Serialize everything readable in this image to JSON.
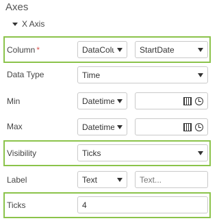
{
  "panel": {
    "title": "Axes",
    "section": "X Axis"
  },
  "rows": {
    "column": {
      "label": "Column",
      "required": "*",
      "source": "DataColu",
      "field": "StartDate"
    },
    "data_type": {
      "label": "Data Type",
      "value": "Time"
    },
    "min": {
      "label": "Min",
      "mode": "Datetime",
      "value": ""
    },
    "max": {
      "label": "Max",
      "mode": "Datetime",
      "value": ""
    },
    "visibility": {
      "label": "Visibility",
      "value": "Ticks"
    },
    "label": {
      "label": "Label",
      "mode": "Text",
      "placeholder": "Text..."
    },
    "ticks": {
      "label": "Ticks",
      "value": "4"
    }
  },
  "colors": {
    "highlight": "#8bc34a",
    "required": "#d9534f"
  }
}
